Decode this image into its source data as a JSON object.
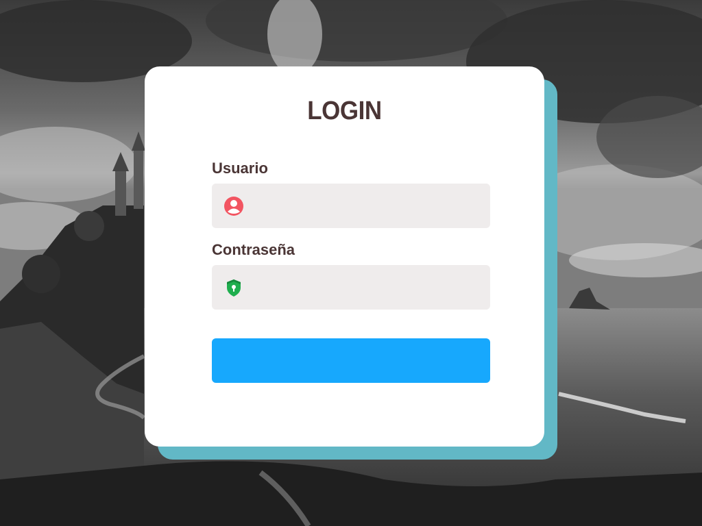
{
  "login": {
    "title": "LOGIN",
    "username": {
      "label": "Usuario",
      "value": "",
      "placeholder": "",
      "icon": "user-icon",
      "icon_color": "#f25461"
    },
    "password": {
      "label": "Contraseña",
      "value": "",
      "placeholder": "",
      "icon": "shield-lock-icon",
      "icon_color": "#1fae4e"
    },
    "submit_label": ""
  },
  "colors": {
    "card": "#ffffff",
    "card_shadow": "#62b8c6",
    "field_background": "#efecec",
    "button": "#17a8fd",
    "text": "#4a3535"
  }
}
